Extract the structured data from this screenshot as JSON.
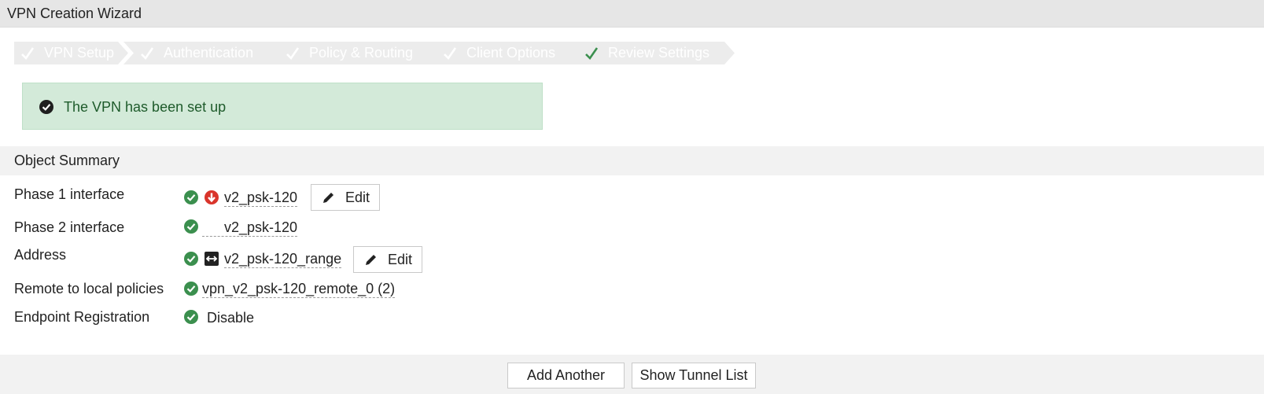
{
  "window": {
    "title": "VPN Creation Wizard"
  },
  "steps": [
    {
      "label": "VPN Setup"
    },
    {
      "label": "Authentication"
    },
    {
      "label": "Policy & Routing"
    },
    {
      "label": "Client Options"
    },
    {
      "label": "Review Settings"
    }
  ],
  "alert": {
    "message": "The VPN has been set up",
    "icon": "check-circle-icon"
  },
  "summary": {
    "title": "Object Summary",
    "rows": [
      {
        "label": "Phase 1 interface",
        "value": "v2_psk-120",
        "edit_label": "Edit"
      },
      {
        "label": "Phase 2 interface",
        "value": "v2_psk-120"
      },
      {
        "label": "Address",
        "value": "v2_psk-120_range",
        "edit_label": "Edit"
      },
      {
        "label": "Remote to local policies",
        "value": "vpn_v2_psk-120_remote_0 (2)"
      },
      {
        "label": "Endpoint Registration",
        "value": "Disable"
      }
    ]
  },
  "footer": {
    "add_another": "Add Another",
    "show_tunnel_list": "Show Tunnel List"
  },
  "colors": {
    "success": "#3b8f4e",
    "alert_bg": "#d3ead9",
    "alert_text": "#1e5b2b",
    "error": "#d9342b",
    "step_bg": "#ececec"
  }
}
